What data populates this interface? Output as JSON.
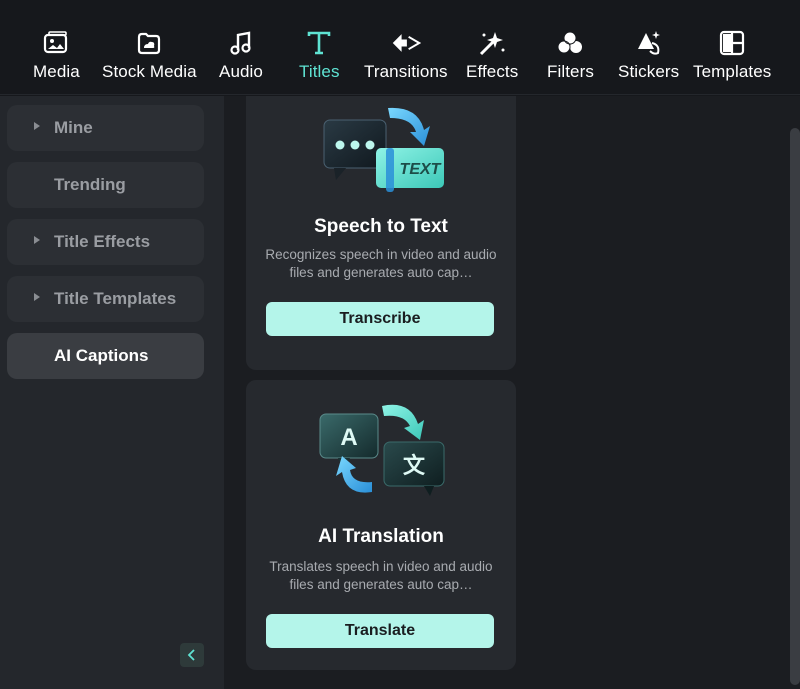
{
  "toolbar": {
    "tabs": [
      {
        "label": "Media",
        "icon": "media-icon"
      },
      {
        "label": "Stock Media",
        "icon": "stock-media-icon"
      },
      {
        "label": "Audio",
        "icon": "music-note-icon"
      },
      {
        "label": "Titles",
        "icon": "title-t-icon"
      },
      {
        "label": "Transitions",
        "icon": "transitions-icon"
      },
      {
        "label": "Effects",
        "icon": "sparkle-effects-icon"
      },
      {
        "label": "Filters",
        "icon": "filters-circles-icon"
      },
      {
        "label": "Stickers",
        "icon": "stickers-icon"
      },
      {
        "label": "Templates",
        "icon": "templates-icon"
      }
    ],
    "active_tab": "Titles"
  },
  "sidebar": {
    "items": [
      {
        "label": "Mine",
        "has_arrow": true
      },
      {
        "label": "Trending",
        "has_arrow": false
      },
      {
        "label": "Title Effects",
        "has_arrow": true
      },
      {
        "label": "Title Templates",
        "has_arrow": true
      },
      {
        "label": "AI Captions",
        "has_arrow": false
      }
    ],
    "active_item": "AI Captions",
    "collapse_icon": "chevron-left-icon"
  },
  "cards": [
    {
      "title": "Speech to Text",
      "description": "Recognizes speech in video and audio files and generates auto cap…",
      "button": "Transcribe",
      "art_text": "TEXT",
      "art_icon": "speech-to-text-illustration"
    },
    {
      "title": "AI Translation",
      "description": "Translates speech in video and audio files and generates auto cap…",
      "button": "Translate",
      "art_letter_a": "A",
      "art_letter_b": "文",
      "art_icon": "ai-translation-illustration"
    }
  ],
  "colors": {
    "accent": "#5fe3d3",
    "button_bg": "#b4f5ea",
    "panel_bg": "#24272c",
    "content_bg": "#1b1d21"
  }
}
